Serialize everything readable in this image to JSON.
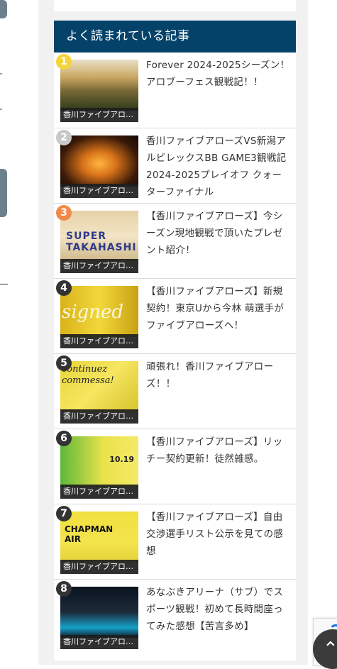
{
  "widget": {
    "title": "よく読まれている記事"
  },
  "articles": [
    {
      "rank": "1",
      "rank_color": "#f4d43a",
      "category": "香川ファイブアロ…",
      "title": "Forever 2024-2025シーズン！アロブーフェス観戦記！！",
      "image": "fans-in-arena"
    },
    {
      "rank": "2",
      "rank_color": "#c8c8c8",
      "category": "香川ファイブアロ…",
      "title": "香川ファイブアローズVS新潟アルビレックスBB GAME3観戦記 2024-2025プレイオフ クォーターファイナル",
      "image": "arena-court-lights"
    },
    {
      "rank": "3",
      "rank_color": "#ef8a4a",
      "category": "香川ファイブアロ…",
      "title": "【香川ファイブアローズ】今シーズン現地観戦で頂いたプレゼント紹介！",
      "image": "super-takahashi-banner"
    },
    {
      "rank": "4",
      "rank_color": "#333333",
      "category": "香川ファイブアロ…",
      "title": "【香川ファイブアローズ】新規契約！東京Uから今林 萌選手がファイブアローズへ！",
      "image": "signed-yellow"
    },
    {
      "rank": "5",
      "rank_color": "#333333",
      "category": "香川ファイブアロ…",
      "title": "頑張れ！香川ファイブアローズ！！",
      "image": "yellow-message-board"
    },
    {
      "rank": "6",
      "rank_color": "#333333",
      "category": "香川ファイブアロ…",
      "title": "【香川ファイブアローズ】リッチー契約更新！徒然雑感。",
      "image": "player-poster"
    },
    {
      "rank": "7",
      "rank_color": "#333333",
      "category": "香川ファイブアロ…",
      "title": "【香川ファイブアローズ】自由交渉選手リスト公示を見ての感想",
      "image": "chapman-air-jersey"
    },
    {
      "rank": "8",
      "rank_color": "#333333",
      "category": "香川ファイブアロ…",
      "title": "あなぶきアリーナ（サブ）でスポーツ観戦！初めて長時間座ってみた感想【苦言多め】",
      "image": "arena-night"
    }
  ],
  "thumb_text": {
    "img3": "SUPER TAKAHASHI",
    "img4": "signed",
    "img5": "continuez\ncommessa!",
    "img6": "10.19",
    "img7": "CHAPMAN\nAIR"
  },
  "icons": {
    "scroll_top": "chevron-up-icon",
    "recaptcha": "recaptcha-icon"
  }
}
